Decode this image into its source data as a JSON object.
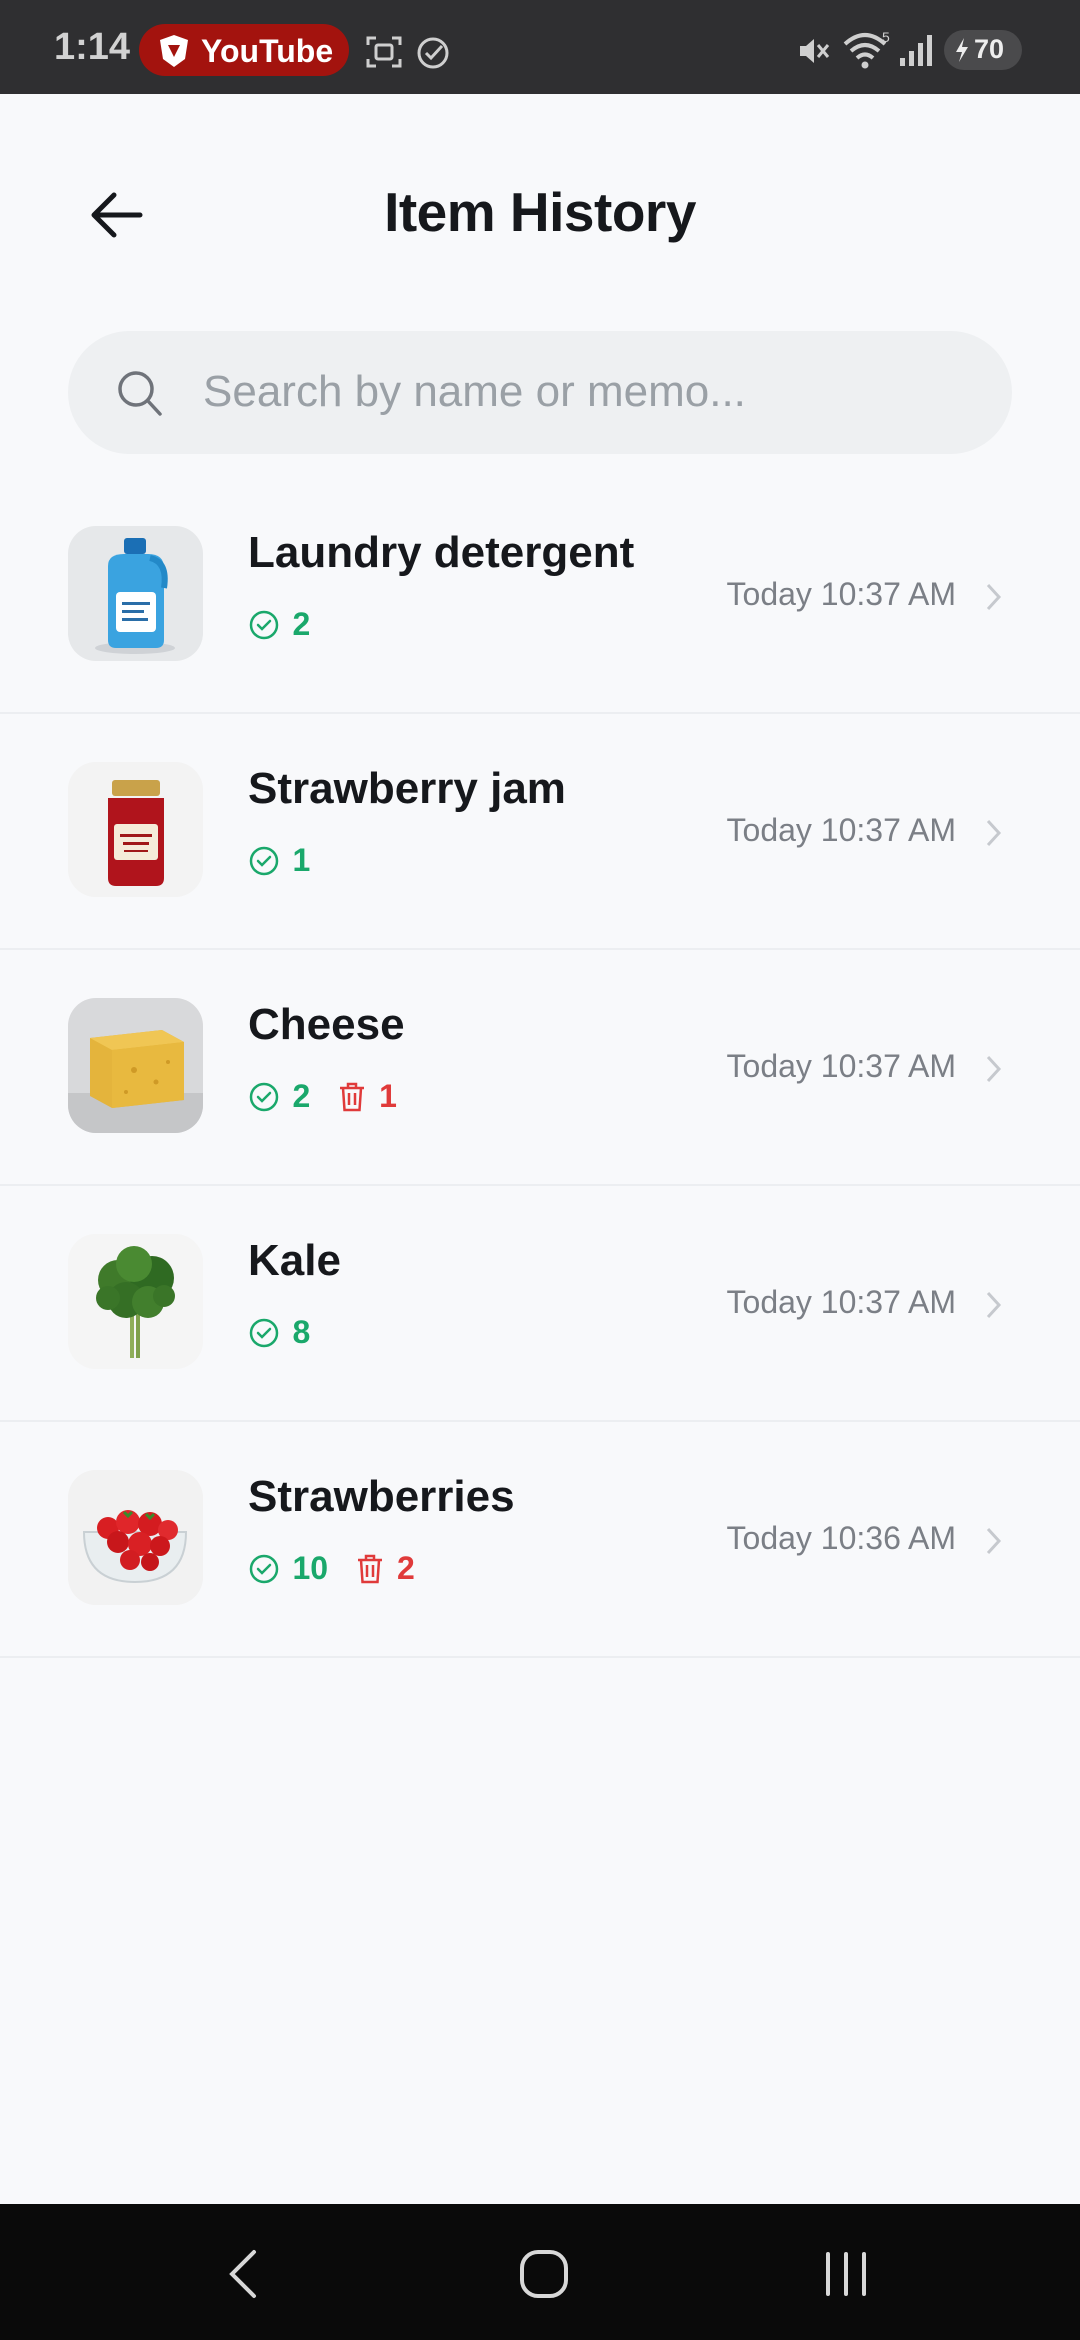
{
  "status_bar": {
    "time": "1:14",
    "app_pill": "YouTube",
    "battery": "70",
    "icons": [
      "screenshot-icon",
      "check-circle-icon",
      "mute-icon",
      "wifi-icon",
      "signal-icon",
      "battery-icon"
    ]
  },
  "header": {
    "title": "Item History",
    "back_icon": "arrow-left-icon"
  },
  "search": {
    "placeholder": "Search by name or memo..."
  },
  "items": [
    {
      "name": "Laundry detergent",
      "thumb": "detergent-bottle",
      "checked": "2",
      "trashed": null,
      "time": "Today 10:37 AM"
    },
    {
      "name": "Strawberry jam",
      "thumb": "jam-jar",
      "checked": "1",
      "trashed": null,
      "time": "Today 10:37 AM"
    },
    {
      "name": "Cheese",
      "thumb": "cheese-block",
      "checked": "2",
      "trashed": "1",
      "time": "Today 10:37 AM"
    },
    {
      "name": "Kale",
      "thumb": "kale-bunch",
      "checked": "8",
      "trashed": null,
      "time": "Today 10:37 AM"
    },
    {
      "name": "Strawberries",
      "thumb": "strawberry-bowl",
      "checked": "10",
      "trashed": "2",
      "time": "Today 10:36 AM"
    }
  ],
  "colors": {
    "accent_green": "#1aa86b",
    "accent_red": "#e03a3a",
    "background": "#f8f9fb"
  },
  "nav_bar": {
    "buttons": [
      "back",
      "home",
      "recents"
    ]
  }
}
